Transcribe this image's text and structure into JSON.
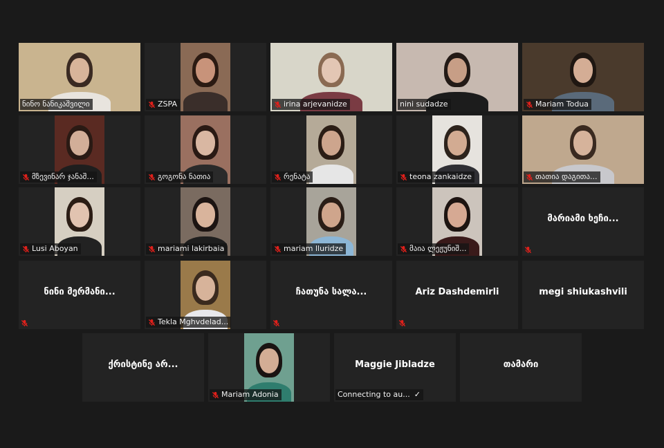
{
  "meeting": {
    "participants": [
      {
        "name": "ნინო ნანიკაშვილი",
        "video": true,
        "muted": false,
        "speaking": true
      },
      {
        "name": "ZSPA",
        "video": true,
        "muted": true
      },
      {
        "name": "irina arjevanidze",
        "video": true,
        "muted": true
      },
      {
        "name": "nini sudadze",
        "video": true,
        "muted": false
      },
      {
        "name": "Mariam Todua",
        "video": true,
        "muted": true
      },
      {
        "name": "მზევინარ ჯანაშ...",
        "video": true,
        "muted": true
      },
      {
        "name": "გოგონა ნათია",
        "video": true,
        "muted": true
      },
      {
        "name": "რენატა",
        "video": true,
        "muted": true
      },
      {
        "name": "teona zankaidze",
        "video": true,
        "muted": true
      },
      {
        "name": "თათია დაგითა...",
        "video": true,
        "muted": true
      },
      {
        "name": "Lusi Aboyan",
        "video": true,
        "muted": true
      },
      {
        "name": "mariami lakirbaia",
        "video": true,
        "muted": true
      },
      {
        "name": "mariam lluridze",
        "video": true,
        "muted": true
      },
      {
        "name": "მაია ლეჟუნიშ...",
        "video": true,
        "muted": true
      },
      {
        "name": "მარიამი ხეჩი...",
        "video": false,
        "muted": true
      },
      {
        "name": "ნინი მერმანი...",
        "video": false,
        "muted": true
      },
      {
        "name": "Tekla Mghvdelad...",
        "video": true,
        "muted": true
      },
      {
        "name": "ჩათუნა სალა...",
        "video": false,
        "muted": true
      },
      {
        "name": "Ariz Dashdemirli",
        "video": false,
        "muted": true
      },
      {
        "name": "megi shiukashvili",
        "video": false,
        "muted": false
      },
      {
        "name": "ქრისტინე არ...",
        "video": false,
        "muted": false
      },
      {
        "name": "Mariam Adonia",
        "video": true,
        "muted": true
      },
      {
        "name": "Maggie Jibladze",
        "video": false,
        "muted": false,
        "status": "Connecting to au...",
        "status_check": "✓"
      },
      {
        "name": "თამარი",
        "video": false,
        "muted": false
      }
    ]
  },
  "icons": {
    "mute": "muted-microphone-icon",
    "check": "checkmark-icon"
  },
  "colors": {
    "background": "#1a1a1a",
    "tile": "#232323",
    "active_speaker_border": "#d5e07a",
    "muted_icon": "#e0201b"
  }
}
